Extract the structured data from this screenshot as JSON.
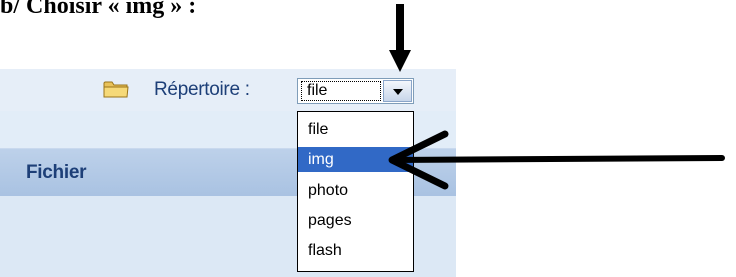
{
  "instruction": {
    "text": "b/ Choisir « img » :"
  },
  "toolbar": {
    "folder_icon": "folder-icon",
    "directory_label": "Répertoire :",
    "select": {
      "value": "file",
      "arrow_icon": "chevron-down-icon"
    }
  },
  "table": {
    "column_header": "Fichier"
  },
  "dropdown": {
    "options": [
      "file",
      "img",
      "photo",
      "pages",
      "flash"
    ],
    "selected": "img",
    "highlight_color": "#3169c6"
  },
  "annotations": {
    "down_arrow_icon": "arrow-down-icon",
    "left_arrow_icon": "arrow-left-icon"
  }
}
